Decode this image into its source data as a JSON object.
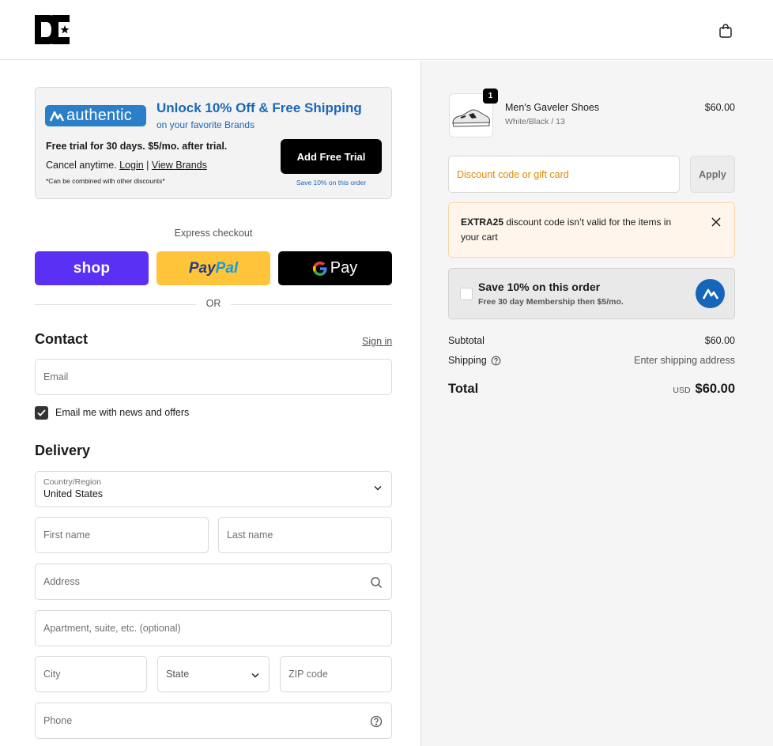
{
  "header": {
    "logo": "dc-logo-icon",
    "cart_icon": "shopping-bag-icon"
  },
  "promo": {
    "brand": "authentic",
    "title": "Unlock 10% Off & Free Shipping",
    "subtitle": "on your favorite Brands",
    "trial_text": "Free trial for 30 days. $5/mo. after trial.",
    "cancel_text": "Cancel anytime.",
    "login_link": "Login",
    "separator": " | ",
    "view_brands_link": "View Brands",
    "note": "*Can be combined with other discounts*",
    "trial_button": "Add Free Trial",
    "trial_button_note": "Save 10% on this order",
    "accent_color": "#1a67b8"
  },
  "express": {
    "label": "Express checkout",
    "shop_label": "shop",
    "paypal_part1": "Pay",
    "paypal_part2": "Pal",
    "gpay_label": "Pay",
    "or_label": "OR"
  },
  "contact": {
    "title": "Contact",
    "sign_in": "Sign in",
    "email_placeholder": "Email",
    "newsletter_label": "Email me with news and offers",
    "newsletter_checked": true
  },
  "delivery": {
    "title": "Delivery",
    "country_label": "Country/Region",
    "country_value": "United States",
    "first_name_placeholder": "First name",
    "last_name_placeholder": "Last name",
    "address_placeholder": "Address",
    "apartment_placeholder": "Apartment, suite, etc. (optional)",
    "city_placeholder": "City",
    "state_label": "State",
    "zip_placeholder": "ZIP code",
    "phone_placeholder": "Phone"
  },
  "order": {
    "product_name": "Men's Gaveler Shoes",
    "product_variant": "White/Black / 13",
    "product_price": "$60.00",
    "quantity": "1",
    "discount_placeholder": "Discount code or gift card",
    "apply_label": "Apply",
    "alert_code": "EXTRA25",
    "alert_message": " discount code isn’t valid for the items in your cart",
    "save_title": "Save 10% on this order",
    "save_sub": "Free 30 day Membership then $5/mo.",
    "subtotal_label": "Subtotal",
    "subtotal_value": "$60.00",
    "shipping_label": "Shipping",
    "shipping_value": "Enter shipping address",
    "total_label": "Total",
    "total_currency": "USD",
    "total_value": "$60.00"
  }
}
